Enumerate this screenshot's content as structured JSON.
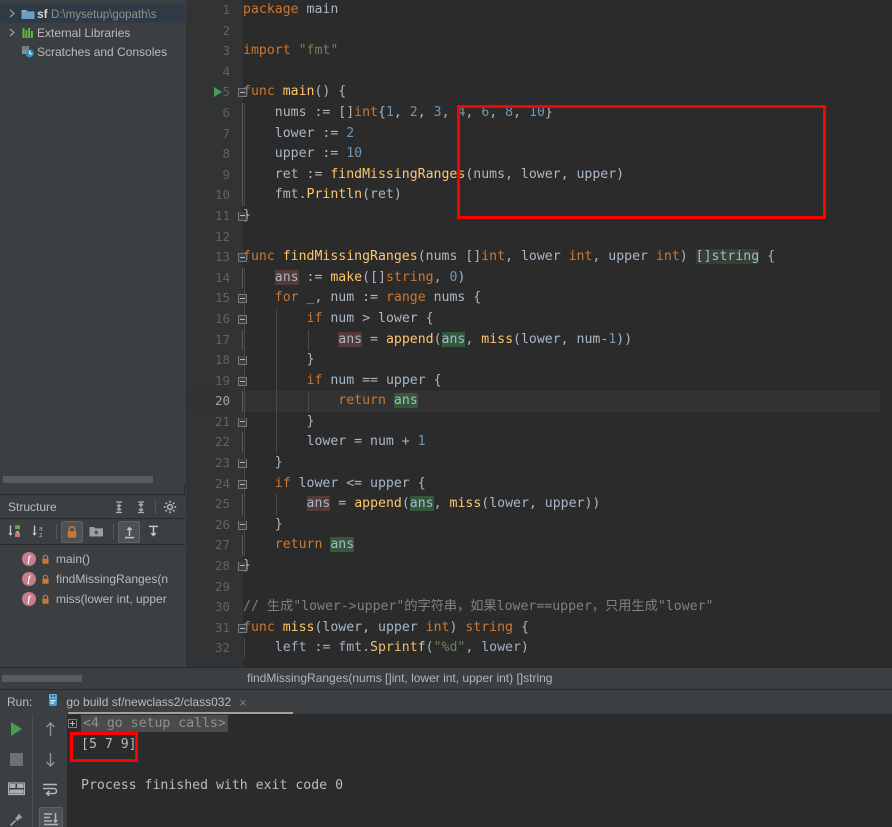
{
  "project_tree": {
    "items": [
      {
        "arrow": "chevron-right",
        "icon": "folder-module-icon",
        "name": "sf",
        "path": "D:\\mysetup\\gopath\\s",
        "selected": true
      },
      {
        "arrow": "chevron-right",
        "icon": "external-libraries-icon",
        "name": "External Libraries",
        "path": "",
        "selected": false
      },
      {
        "arrow": "",
        "icon": "scratches-icon",
        "name": "Scratches and Consoles",
        "path": "",
        "selected": false
      }
    ]
  },
  "structure": {
    "title": "Structure",
    "header_buttons": [
      "expand-all-icon",
      "collapse-all-icon",
      "settings-gear-icon"
    ],
    "toolbar_buttons": [
      "sort-by-visibility-icon",
      "sort-alphabetically-icon",
      "show-non-public-icon",
      "group-icon",
      "show-inherited-icon",
      "show-anonymous-icon"
    ],
    "items": [
      {
        "icon": "function-icon",
        "lock": "lock-icon",
        "label": "main()"
      },
      {
        "icon": "function-icon",
        "lock": "lock-icon",
        "label": "findMissingRanges(n"
      },
      {
        "icon": "function-icon",
        "lock": "lock-icon",
        "label": "miss(lower int, upper"
      }
    ]
  },
  "editor": {
    "lines": [
      {
        "n": "1",
        "tokens": [
          {
            "t": "package",
            "c": "kw"
          },
          {
            "t": " ",
            "c": "txt"
          },
          {
            "t": "main",
            "c": "txt"
          }
        ]
      },
      {
        "n": "2",
        "tokens": []
      },
      {
        "n": "3",
        "tokens": [
          {
            "t": "import",
            "c": "kw"
          },
          {
            "t": " ",
            "c": "txt"
          },
          {
            "t": "\"fmt\"",
            "c": "str"
          }
        ]
      },
      {
        "n": "4",
        "tokens": []
      },
      {
        "n": "5",
        "tokens": [
          {
            "t": "func",
            "c": "kw"
          },
          {
            "t": " ",
            "c": "txt"
          },
          {
            "t": "main",
            "c": "fn"
          },
          {
            "t": "() {",
            "c": "txt"
          }
        ],
        "run": true,
        "fold": "start"
      },
      {
        "n": "6",
        "tokens": [
          {
            "t": "    nums := []",
            "c": "txt"
          },
          {
            "t": "int",
            "c": "typ"
          },
          {
            "t": "{",
            "c": "txt"
          },
          {
            "t": "1",
            "c": "num"
          },
          {
            "t": ", ",
            "c": "txt"
          },
          {
            "t": "2",
            "c": "num"
          },
          {
            "t": ", ",
            "c": "txt"
          },
          {
            "t": "3",
            "c": "num"
          },
          {
            "t": ", ",
            "c": "txt"
          },
          {
            "t": "4",
            "c": "num"
          },
          {
            "t": ", ",
            "c": "txt"
          },
          {
            "t": "6",
            "c": "num"
          },
          {
            "t": ", ",
            "c": "txt"
          },
          {
            "t": "8",
            "c": "num"
          },
          {
            "t": ", ",
            "c": "txt"
          },
          {
            "t": "10",
            "c": "num"
          },
          {
            "t": "}",
            "c": "txt"
          }
        ]
      },
      {
        "n": "7",
        "tokens": [
          {
            "t": "    lower := ",
            "c": "txt"
          },
          {
            "t": "2",
            "c": "num"
          }
        ]
      },
      {
        "n": "8",
        "tokens": [
          {
            "t": "    upper := ",
            "c": "txt"
          },
          {
            "t": "10",
            "c": "num"
          }
        ]
      },
      {
        "n": "9",
        "tokens": [
          {
            "t": "    ret := ",
            "c": "txt"
          },
          {
            "t": "findMissingRanges",
            "c": "fn"
          },
          {
            "t": "(nums, lower, upper)",
            "c": "txt"
          }
        ]
      },
      {
        "n": "10",
        "tokens": [
          {
            "t": "    fmt.",
            "c": "txt"
          },
          {
            "t": "Println",
            "c": "fn"
          },
          {
            "t": "(ret)",
            "c": "txt"
          }
        ]
      },
      {
        "n": "11",
        "tokens": [
          {
            "t": "}",
            "c": "txt"
          }
        ],
        "fold": "end"
      },
      {
        "n": "12",
        "tokens": []
      },
      {
        "n": "13",
        "tokens": [
          {
            "t": "func",
            "c": "kw"
          },
          {
            "t": " ",
            "c": "txt"
          },
          {
            "t": "findMissingRanges",
            "c": "fn"
          },
          {
            "t": "(nums []",
            "c": "txt"
          },
          {
            "t": "int",
            "c": "typ"
          },
          {
            "t": ", lower ",
            "c": "txt"
          },
          {
            "t": "int",
            "c": "typ"
          },
          {
            "t": ", upper ",
            "c": "txt"
          },
          {
            "t": "int",
            "c": "typ"
          },
          {
            "t": ") ",
            "c": "txt"
          },
          {
            "t": "[]string",
            "c": "hl-g"
          },
          {
            "t": " {",
            "c": "txt"
          }
        ],
        "fold": "start"
      },
      {
        "n": "14",
        "tokens": [
          {
            "t": "    ",
            "c": "txt"
          },
          {
            "t": "ans",
            "c": "hl-w"
          },
          {
            "t": " := ",
            "c": "txt"
          },
          {
            "t": "make",
            "c": "fn"
          },
          {
            "t": "([]",
            "c": "txt"
          },
          {
            "t": "string",
            "c": "typ"
          },
          {
            "t": ", ",
            "c": "txt"
          },
          {
            "t": "0",
            "c": "num"
          },
          {
            "t": ")",
            "c": "txt"
          }
        ]
      },
      {
        "n": "15",
        "tokens": [
          {
            "t": "    ",
            "c": "txt"
          },
          {
            "t": "for",
            "c": "kw"
          },
          {
            "t": " _, num := ",
            "c": "txt"
          },
          {
            "t": "range",
            "c": "kw"
          },
          {
            "t": " nums {",
            "c": "txt"
          }
        ],
        "fold": "start"
      },
      {
        "n": "16",
        "tokens": [
          {
            "t": "        ",
            "c": "txt"
          },
          {
            "t": "if",
            "c": "kw"
          },
          {
            "t": " num > lower {",
            "c": "txt"
          }
        ],
        "fold": "start"
      },
      {
        "n": "17",
        "tokens": [
          {
            "t": "            ",
            "c": "txt"
          },
          {
            "t": "ans",
            "c": "hl-w"
          },
          {
            "t": " = ",
            "c": "txt"
          },
          {
            "t": "append",
            "c": "fn"
          },
          {
            "t": "(",
            "c": "txt"
          },
          {
            "t": "ans",
            "c": "hl-r"
          },
          {
            "t": ", ",
            "c": "txt"
          },
          {
            "t": "miss",
            "c": "fn"
          },
          {
            "t": "(lower, num-",
            "c": "txt"
          },
          {
            "t": "1",
            "c": "num"
          },
          {
            "t": "))",
            "c": "txt"
          }
        ]
      },
      {
        "n": "18",
        "tokens": [
          {
            "t": "        }",
            "c": "txt"
          }
        ],
        "fold": "end"
      },
      {
        "n": "19",
        "tokens": [
          {
            "t": "        ",
            "c": "txt"
          },
          {
            "t": "if",
            "c": "kw"
          },
          {
            "t": " num == upper {",
            "c": "txt"
          }
        ],
        "fold": "start"
      },
      {
        "n": "20",
        "tokens": [
          {
            "t": "            ",
            "c": "txt"
          },
          {
            "t": "return",
            "c": "kw"
          },
          {
            "t": " ",
            "c": "txt"
          },
          {
            "t": "ans",
            "c": "hl-r"
          }
        ],
        "highlight": true
      },
      {
        "n": "21",
        "tokens": [
          {
            "t": "        }",
            "c": "txt"
          }
        ],
        "fold": "end"
      },
      {
        "n": "22",
        "tokens": [
          {
            "t": "        lower = num + ",
            "c": "txt"
          },
          {
            "t": "1",
            "c": "num"
          }
        ]
      },
      {
        "n": "23",
        "tokens": [
          {
            "t": "    }",
            "c": "txt"
          }
        ],
        "fold": "end"
      },
      {
        "n": "24",
        "tokens": [
          {
            "t": "    ",
            "c": "txt"
          },
          {
            "t": "if",
            "c": "kw"
          },
          {
            "t": " lower <= upper {",
            "c": "txt"
          }
        ],
        "fold": "start"
      },
      {
        "n": "25",
        "tokens": [
          {
            "t": "        ",
            "c": "txt"
          },
          {
            "t": "ans",
            "c": "hl-w"
          },
          {
            "t": " = ",
            "c": "txt"
          },
          {
            "t": "append",
            "c": "fn"
          },
          {
            "t": "(",
            "c": "txt"
          },
          {
            "t": "ans",
            "c": "hl-r"
          },
          {
            "t": ", ",
            "c": "txt"
          },
          {
            "t": "miss",
            "c": "fn"
          },
          {
            "t": "(lower, upper))",
            "c": "txt"
          }
        ]
      },
      {
        "n": "26",
        "tokens": [
          {
            "t": "    }",
            "c": "txt"
          }
        ],
        "fold": "end"
      },
      {
        "n": "27",
        "tokens": [
          {
            "t": "    ",
            "c": "txt"
          },
          {
            "t": "return",
            "c": "kw"
          },
          {
            "t": " ",
            "c": "txt"
          },
          {
            "t": "ans",
            "c": "hl-r"
          }
        ]
      },
      {
        "n": "28",
        "tokens": [
          {
            "t": "}",
            "c": "txt"
          }
        ],
        "fold": "end"
      },
      {
        "n": "29",
        "tokens": []
      },
      {
        "n": "30",
        "tokens": [
          {
            "t": "// 生成\"lower->upper\"的字符串，如果lower==upper，只用生成\"lower\"",
            "c": "cmt"
          }
        ]
      },
      {
        "n": "31",
        "tokens": [
          {
            "t": "func",
            "c": "kw"
          },
          {
            "t": " ",
            "c": "txt"
          },
          {
            "t": "miss",
            "c": "fn"
          },
          {
            "t": "(lower, upper ",
            "c": "txt"
          },
          {
            "t": "int",
            "c": "typ"
          },
          {
            "t": ") ",
            "c": "txt"
          },
          {
            "t": "string",
            "c": "typ"
          },
          {
            "t": " {",
            "c": "txt"
          }
        ],
        "fold": "start"
      },
      {
        "n": "32",
        "tokens": [
          {
            "t": "    left := fmt.",
            "c": "txt"
          },
          {
            "t": "Sprintf",
            "c": "fn"
          },
          {
            "t": "(",
            "c": "txt"
          },
          {
            "t": "\"%d\"",
            "c": "str"
          },
          {
            "t": ", lower)",
            "c": "txt"
          }
        ],
        "clipped": true
      }
    ]
  },
  "breadcrumb": {
    "text": "findMissingRanges(nums []int, lower int, upper int) []string"
  },
  "run_panel": {
    "label": "Run:",
    "tab_icon": "go-run-config-icon",
    "tab_title": "go build sf/newclass2/class032",
    "close_icon": "close-icon",
    "side_buttons": [
      "rerun-icon",
      "stop-icon",
      "layout-icon",
      "pin-icon",
      "up-arrow-icon",
      "down-arrow-icon",
      "soft-wrap-icon",
      "scroll-to-end-icon"
    ],
    "console_lines": [
      {
        "text": "<4 go setup calls>",
        "folded": true
      },
      {
        "text": "[5 7 9]",
        "folded": false,
        "boxed": true
      },
      {
        "text": "",
        "folded": false
      },
      {
        "text": "Process finished with exit code 0",
        "folded": false
      }
    ]
  },
  "colors": {
    "annotation_red": "#ff0000",
    "editor_bg": "#2b2b2b",
    "panel_bg": "#3c3f41",
    "keyword": "#cc7832",
    "string": "#6a8759",
    "number": "#6897bb",
    "function": "#ffc66d",
    "comment": "#808080",
    "default_text": "#a9b7c6",
    "selection_tree": "#2f3a45",
    "write_occurrence": "#553a38",
    "read_occurrence": "#32593d"
  }
}
